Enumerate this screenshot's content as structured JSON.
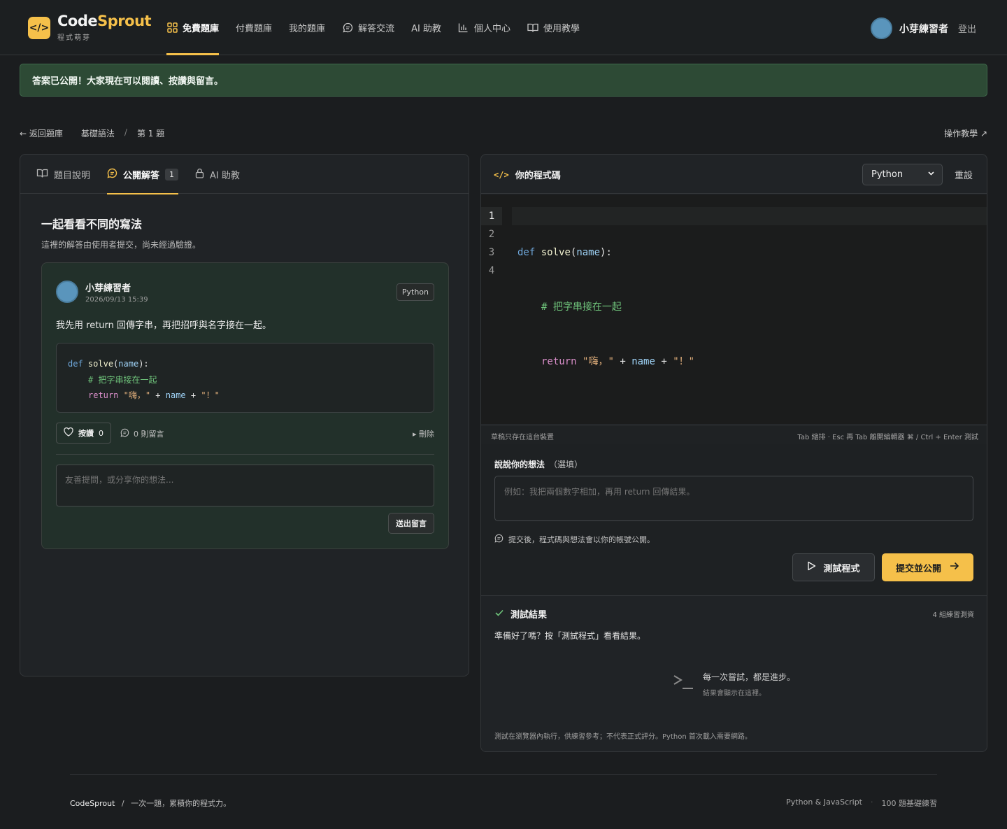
{
  "brand": {
    "name_part1": "Code",
    "name_part2": "Sprout",
    "subtitle": "程式萌芽",
    "logo_glyph": "</>",
    "accent_color": "#f5c04a"
  },
  "nav": {
    "items": [
      {
        "label": "免費題庫",
        "icon": "grid-icon",
        "active": true
      },
      {
        "label": "付費題庫",
        "icon": "none"
      },
      {
        "label": "我的題庫",
        "icon": "none"
      },
      {
        "label": "解答交流",
        "icon": "chat-icon"
      },
      {
        "label": "AI 助教",
        "icon": "none"
      },
      {
        "label": "個人中心",
        "icon": "bar-chart-icon"
      },
      {
        "label": "使用教學",
        "icon": "book-icon"
      }
    ]
  },
  "user": {
    "name": "小芽練習者",
    "logout_label": "登出"
  },
  "banner": {
    "text": "答案已公開！大家現在可以閱讀、按讚與留言。",
    "color": "#2d4a35"
  },
  "breadcrumb": {
    "back_label": "← 返回題庫",
    "category": "基礎語法",
    "separator": "/",
    "current": "第 1 題"
  },
  "tutorial_link": "操作教學 ↗",
  "left_panel": {
    "tabs": [
      {
        "label": "題目說明",
        "icon": "book-icon"
      },
      {
        "label": "公開解答",
        "icon": "chat-icon",
        "badge": "1",
        "active": true
      },
      {
        "label": "AI 助教",
        "icon": "lock-icon"
      }
    ],
    "section_title": "一起看看不同的寫法",
    "section_desc": "這裡的解答由使用者提交，尚未經過驗證。",
    "answer": {
      "author": "小芽練習者",
      "time": "2026/09/13 15:39",
      "language": "Python",
      "text": "我先用 return 回傳字串，再把招呼與名字接在一起。",
      "code": {
        "line1_kw": "def",
        "line1_fn": "solve",
        "line1_open": "(",
        "line1_param": "name",
        "line1_close": "):",
        "line2_comment": "# 把字串接在一起",
        "line3_kw": "return",
        "line3_str1": "\"嗨，\"",
        "line3_plus1": "+",
        "line3_var": "name",
        "line3_plus2": "+",
        "line3_str2": "\"！\""
      },
      "like_label": "按讚",
      "like_count": "0",
      "comment_count_label": "0 則留言",
      "delete_label": "▸ 刪除",
      "comment_placeholder": "友善提問，或分享你的想法...",
      "send_label": "送出留言"
    }
  },
  "editor": {
    "title_tag": "</>",
    "title": "你的程式碼",
    "language_selected": "Python",
    "reset_label": "重設",
    "line_numbers": [
      "1",
      "2",
      "3",
      "4"
    ],
    "code": {
      "line1_kw": "def",
      "line1_fn": "solve",
      "line1_open": "(",
      "line1_param": "name",
      "line1_close": "):",
      "line2_comment": "# 把字串接在一起",
      "line3_kw": "return",
      "line3_str1": "\"嗨，\"",
      "line3_plus1": "+",
      "line3_var": "name",
      "line3_plus2": "+",
      "line3_str2": "\"！\""
    },
    "status_left": "草稿只存在這台裝置",
    "status_right": "Tab 縮排 · Esc 再 Tab 離開編輯器    ⌘ / Ctrl + Enter 測試"
  },
  "notes": {
    "label": "說說你的想法",
    "optional": "（選填）",
    "placeholder": "例如：我把兩個數字相加，再用 return 回傳結果。",
    "hint": "提交後，程式碼與想法會以你的帳號公開。",
    "test_label": "測試程式",
    "submit_label": "提交並公開"
  },
  "results": {
    "title": "測試結果",
    "count": "4 組練習測資",
    "ready_text": "準備好了嗎？按「測試程式」看看結果。",
    "empty_title": "每一次嘗試，都是進步。",
    "empty_sub": "結果會顯示在這裡。",
    "footnote": "測試在瀏覽器內執行，供練習參考；不代表正式評分。Python 首次載入需要網路。"
  },
  "footer": {
    "brand": "CodeSprout",
    "sep": "/",
    "tagline": "一次一題，累積你的程式力。",
    "right1": "Python & JavaScript",
    "dot": "·",
    "right2": "100 題基礎練習"
  }
}
